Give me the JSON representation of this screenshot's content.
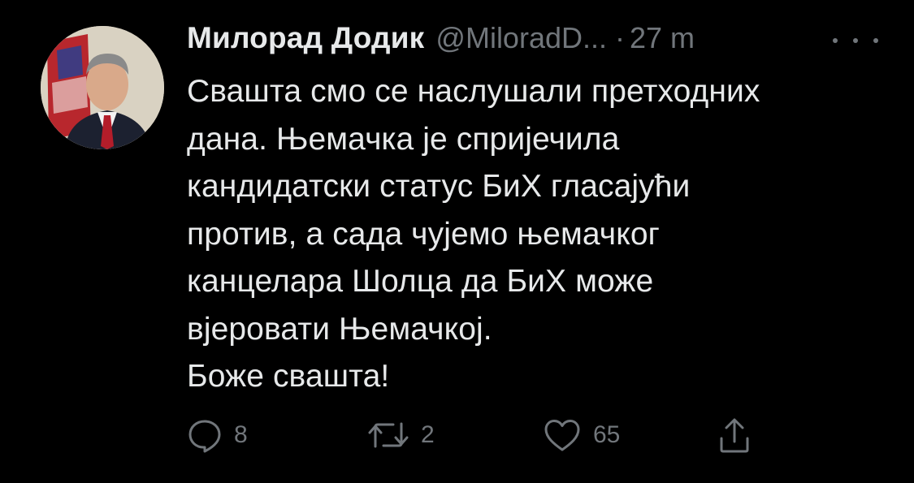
{
  "tweet": {
    "author": {
      "display_name": "Милорад Додик",
      "handle": "@MiloradD...",
      "avatar": "profile-photo"
    },
    "separator": "·",
    "timestamp": "27 m",
    "more_icon": "more-horizontal-icon",
    "text_lines": [
      "Свашта смо се наслушали претходних",
      "дана. Њемачка је спријечила",
      "кандидатски статус БиХ гласајући",
      "против, а сада чујемо њемачког",
      "канцелара Шолца да БиХ може",
      "вјеровати Њемачкој.",
      "Боже свашта!"
    ],
    "actions": {
      "reply": {
        "icon": "reply-icon",
        "count": "8"
      },
      "retweet": {
        "icon": "retweet-icon",
        "count": "2"
      },
      "like": {
        "icon": "heart-icon",
        "count": "65"
      },
      "share": {
        "icon": "share-icon"
      }
    }
  },
  "colors": {
    "background": "#000000",
    "primary_text": "#e7e9ea",
    "secondary_text": "#71767b"
  }
}
